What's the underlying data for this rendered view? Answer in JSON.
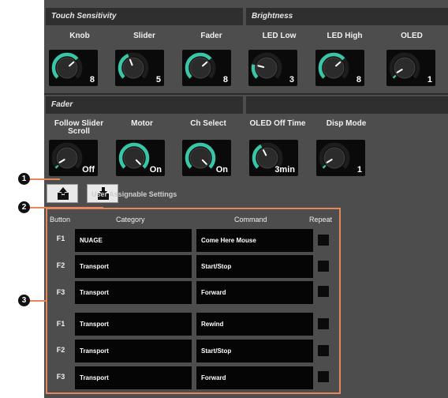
{
  "sections": {
    "touch": "Touch Sensitivity",
    "brightness": "Brightness",
    "fader": "Fader"
  },
  "row1": [
    {
      "label": "Knob",
      "value": "8",
      "level": 0.68
    },
    {
      "label": "Slider",
      "value": "5",
      "level": 0.42
    },
    {
      "label": "Fader",
      "value": "8",
      "level": 0.68
    },
    {
      "label": "LED Low",
      "value": "3",
      "level": 0.22
    },
    {
      "label": "LED High",
      "value": "8",
      "level": 0.68
    },
    {
      "label": "OLED",
      "value": "1",
      "level": 0.05
    }
  ],
  "row2": [
    {
      "label": "Follow Slider",
      "label2": "Scroll",
      "value": "Off",
      "level": 0.05
    },
    {
      "label": "Motor",
      "value": "On",
      "level": 1.0
    },
    {
      "label": "Ch Select",
      "value": "On",
      "level": 1.0
    },
    {
      "label": "OLED Off Time",
      "value": "3min",
      "level": 0.4
    },
    {
      "label": "Disp Mode",
      "value": "1",
      "level": 0.05
    }
  ],
  "colors": {
    "accent": "#39c6a8",
    "callout_line": "#e5875a"
  },
  "user_assignable_label": "User Assignable Settings",
  "callouts": [
    "1",
    "2",
    "3"
  ],
  "table": {
    "headers": {
      "button": "Button",
      "category": "Category",
      "command": "Command",
      "repeat": "Repeat"
    },
    "rows": [
      {
        "key": "F1",
        "category": "NUAGE",
        "command": "Come Here Mouse",
        "repeat": false
      },
      {
        "key": "F2",
        "category": "Transport",
        "command": "Start/Stop",
        "repeat": false
      },
      {
        "key": "F3",
        "category": "Transport",
        "command": "Forward",
        "repeat": false
      },
      {
        "key": "F1",
        "category": "Transport",
        "command": "Rewind",
        "repeat": false
      },
      {
        "key": "F2",
        "category": "Transport",
        "command": "Start/Stop",
        "repeat": false
      },
      {
        "key": "F3",
        "category": "Transport",
        "command": "Forward",
        "repeat": false
      }
    ]
  }
}
